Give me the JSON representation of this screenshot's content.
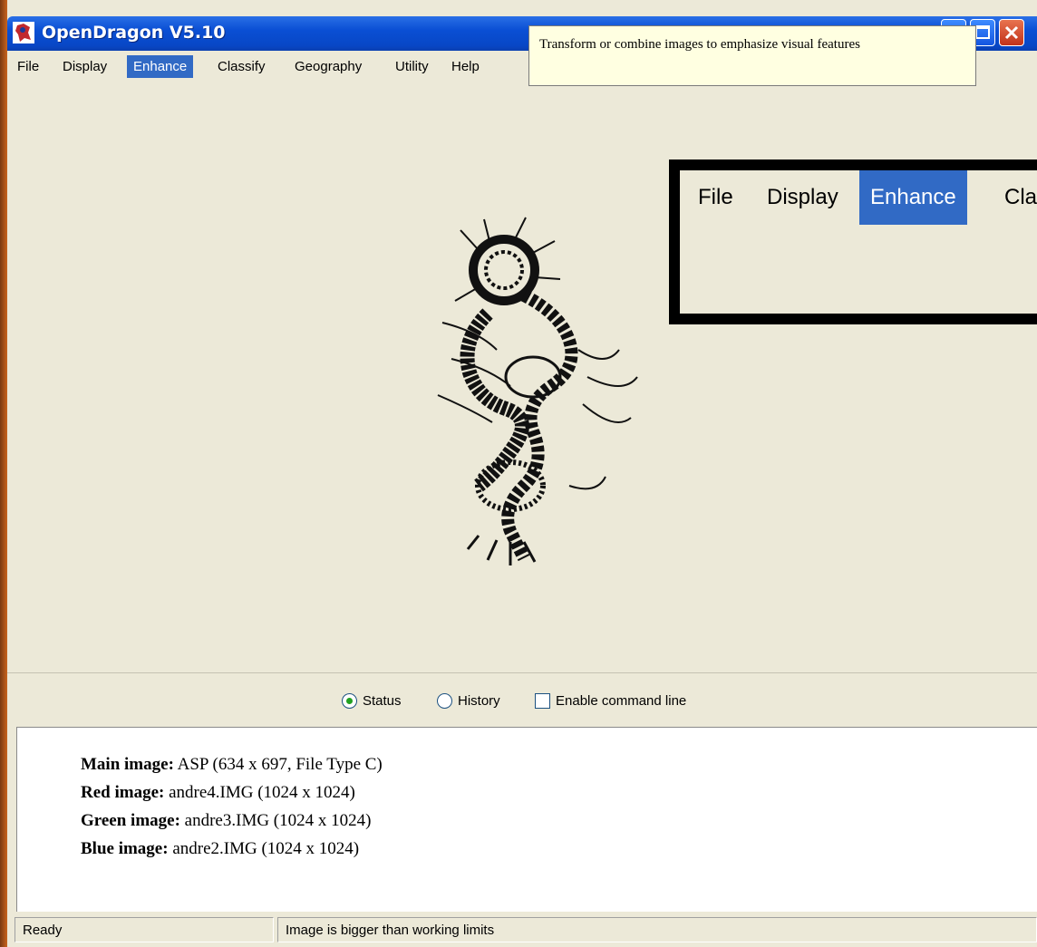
{
  "window": {
    "title": "OpenDragon V5.10"
  },
  "menubar": {
    "items": [
      {
        "label": "File"
      },
      {
        "label": "Display"
      },
      {
        "label": "Enhance"
      },
      {
        "label": "Classify"
      },
      {
        "label": "Geography"
      },
      {
        "label": "Utility"
      },
      {
        "label": "Help"
      }
    ],
    "active": "Enhance"
  },
  "tooltip": {
    "text": "Transform or combine images to emphasize visual features"
  },
  "zoom_inset": {
    "items": [
      {
        "label": "File"
      },
      {
        "label": "Display"
      },
      {
        "label": "Enhance"
      },
      {
        "label": "Cla"
      }
    ]
  },
  "options": {
    "status_label": "Status",
    "status_selected": true,
    "history_label": "History",
    "history_selected": false,
    "command_line_label": "Enable command line",
    "command_line_checked": false
  },
  "info": {
    "main_label": "Main image:",
    "main_value": "ASP  (634 x 697,  File Type C)",
    "red_label": "Red image:",
    "red_value": "andre4.IMG  (1024 x 1024)",
    "green_label": "Green image:",
    "green_value": "andre3.IMG  (1024 x 1024)",
    "blue_label": "Blue image:",
    "blue_value": "andre2.IMG  (1024 x 1024)"
  },
  "statusbar": {
    "left": "Ready",
    "right": "Image is bigger than working limits"
  },
  "icons": {
    "app": "dragon-app-icon",
    "minimize": "minimize-icon",
    "maximize": "maximize-icon",
    "close": "close-icon"
  },
  "colors": {
    "titlebar": "#0a4fd4",
    "menu_highlight": "#316ac5",
    "tooltip_bg": "#ffffe1",
    "window_bg": "#ece9d8"
  }
}
